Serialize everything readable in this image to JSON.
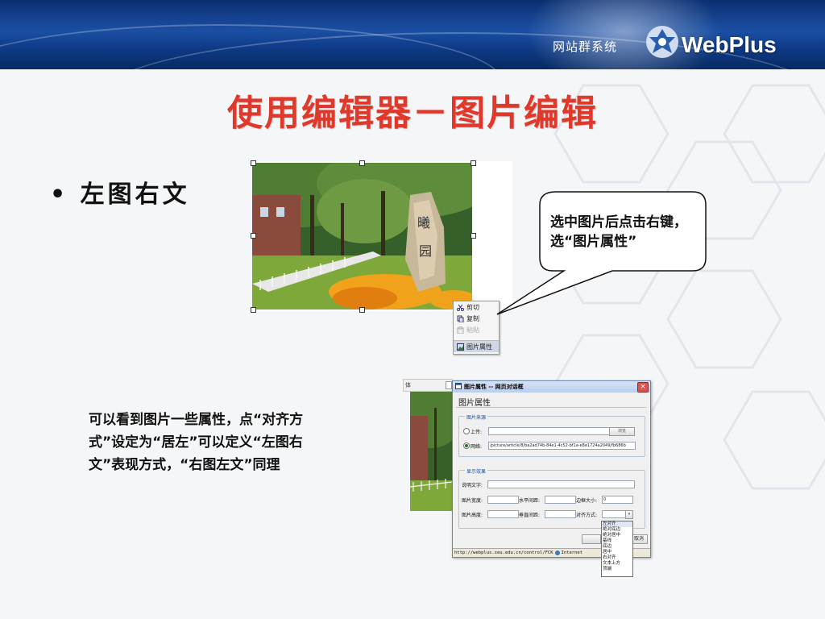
{
  "header": {
    "system_label": "网站群系统",
    "brand_name": "WebPlus",
    "colors": {
      "header_bg": "#0e3a86",
      "title_red": "#e0382a"
    }
  },
  "slide": {
    "title": "使用编辑器－图片编辑",
    "bullet": "左图右文",
    "callout": "选中图片后点击右键，选“图片属性”",
    "description": "可以看到图片一些属性，点“对齐方式”设定为“居左”可以定义“左图右文”表现方式，“右图左文”同理"
  },
  "context_menu": {
    "items": [
      {
        "label": "剪切",
        "icon": "scissors-icon",
        "enabled": true
      },
      {
        "label": "复制",
        "icon": "copy-icon",
        "enabled": true
      },
      {
        "label": "粘贴",
        "icon": "paste-icon",
        "enabled": false
      },
      {
        "label": "图片属性",
        "icon": "image-properties-icon",
        "enabled": true,
        "highlighted": true
      }
    ]
  },
  "editor_toolbar": {
    "font_label": "体"
  },
  "dialog": {
    "window_title": "图片属性 -- 网页对话框",
    "heading": "图片属性",
    "source_group": {
      "legend": "图片来源",
      "upload_label": "上传:",
      "browse_label": "浏览",
      "web_label": "网络:",
      "web_value": "/picture/article/8/ba2ad74b-84e1-4c52-bf1a-e8e1724a2049/fb686b",
      "selected": "web"
    },
    "display_group": {
      "legend": "显示效果",
      "alt_label": "说明文字:",
      "alt_value": "",
      "width_label": "图片宽度:",
      "width_value": "",
      "hspace_label": "水平间距:",
      "hspace_value": "",
      "border_label": "边框大小:",
      "border_value": "0",
      "height_label": "图片高度:",
      "height_value": "",
      "vspace_label": "垂直间距:",
      "vspace_value": "",
      "align_label": "对齐方式:",
      "align_value": ""
    },
    "cancel_label": "取消",
    "statusbar_url": "http://webplus.seu.edu.cn/control/FCK",
    "statusbar_zone": "Internet"
  },
  "align_options": [
    "左对齐",
    "绝对底边",
    "绝对居中",
    "基线",
    "底边",
    "居中",
    "右对齐",
    "文本上方",
    "顶端"
  ]
}
